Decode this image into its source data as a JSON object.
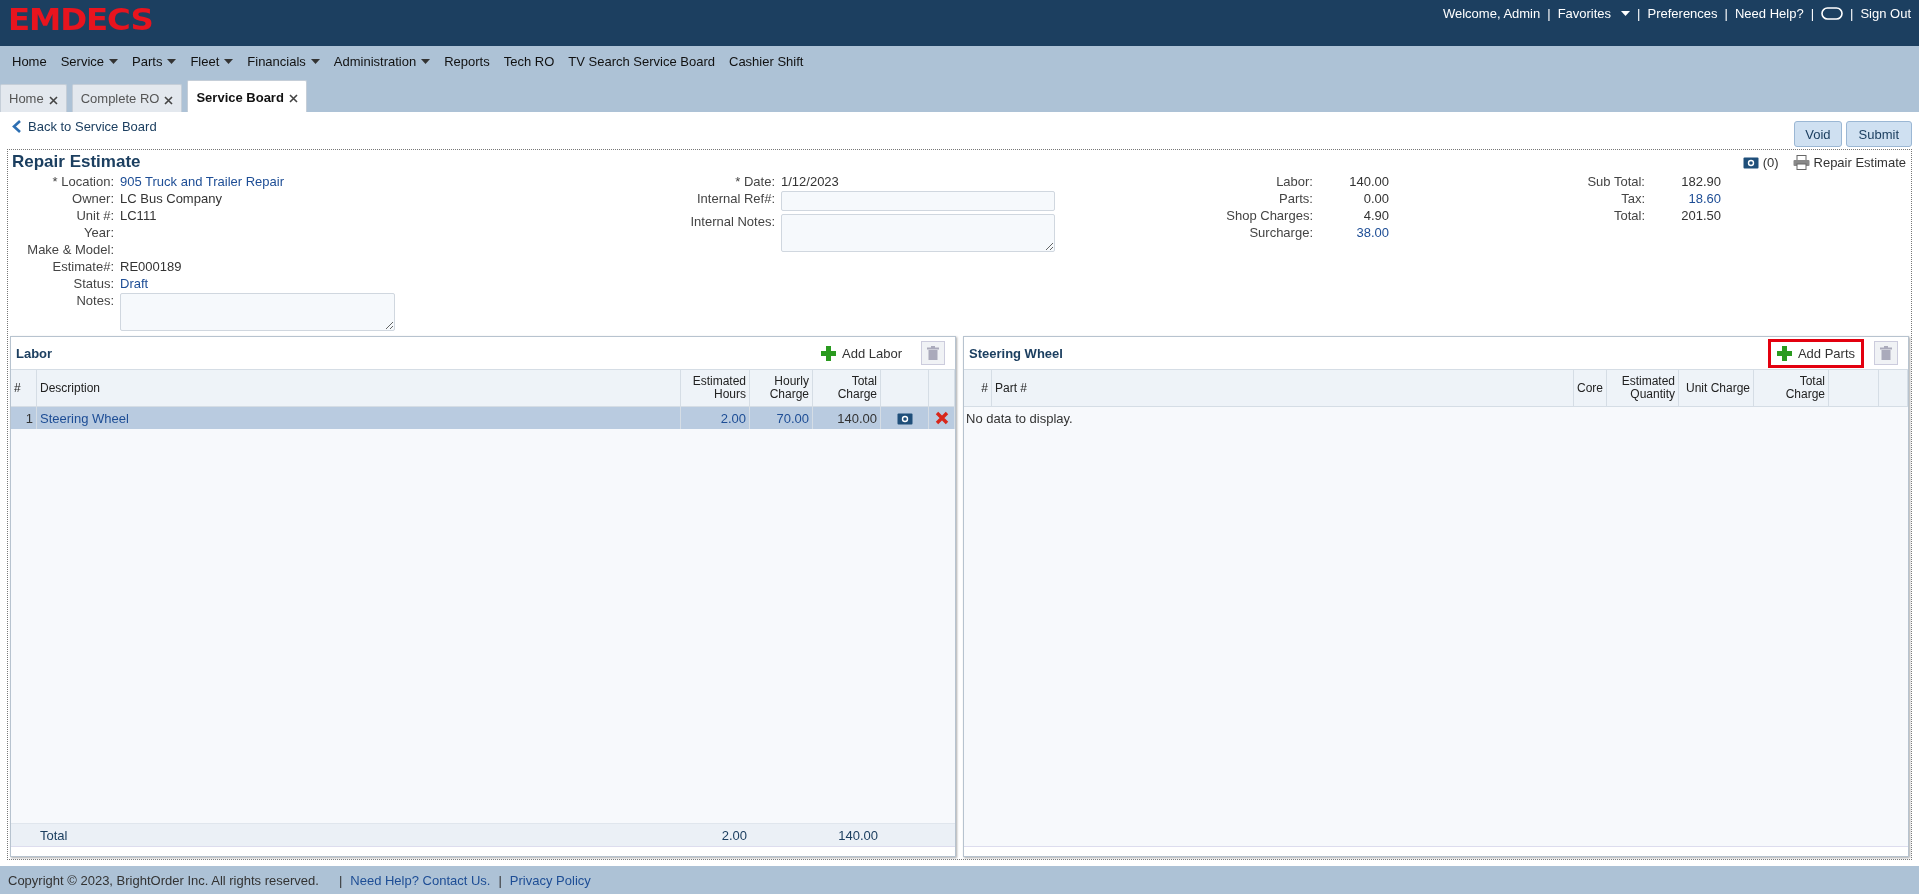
{
  "app": {
    "logo": "EMDECS"
  },
  "user_menu": {
    "separator": "|",
    "items": [
      {
        "kind": "text",
        "label": "Welcome, Admin"
      },
      {
        "kind": "dropdown",
        "label": "Favorites"
      },
      {
        "kind": "link",
        "label": "Preferences"
      },
      {
        "kind": "link",
        "label": "Need Help?"
      },
      {
        "kind": "chat"
      },
      {
        "kind": "link",
        "label": "Sign Out"
      }
    ]
  },
  "nav": [
    {
      "label": "Home",
      "dropdown": false
    },
    {
      "label": "Service",
      "dropdown": true
    },
    {
      "label": "Parts",
      "dropdown": true
    },
    {
      "label": "Fleet",
      "dropdown": true
    },
    {
      "label": "Financials",
      "dropdown": true
    },
    {
      "label": "Administration",
      "dropdown": true
    },
    {
      "label": "Reports",
      "dropdown": false
    },
    {
      "label": "Tech RO",
      "dropdown": false
    },
    {
      "label": "TV Search Service Board",
      "dropdown": false
    },
    {
      "label": "Cashier Shift",
      "dropdown": false
    }
  ],
  "tabs": [
    {
      "label": "Home",
      "selected": false
    },
    {
      "label": "Complete RO",
      "selected": false
    },
    {
      "label": "Service Board",
      "selected": true
    }
  ],
  "back_link": "Back to Service Board",
  "actions": [
    "Void",
    "Submit"
  ],
  "estimate": {
    "title": "Repair Estimate",
    "photo_count": "(0)",
    "print_label": "Repair Estimate",
    "fields_left": [
      {
        "label": "* Location:",
        "kind": "link",
        "value": "905 Truck and Trailer Repair"
      },
      {
        "label": "Owner:",
        "kind": "text",
        "value": "LC Bus Company"
      },
      {
        "label": "Unit #:",
        "kind": "text",
        "value": "LC111"
      },
      {
        "label": "Year:",
        "kind": "text"
      },
      {
        "label": "Make & Model:",
        "kind": "text"
      },
      {
        "label": "Estimate#:",
        "kind": "text",
        "value": "RE000189"
      },
      {
        "label": "Status:",
        "kind": "link",
        "value": "Draft"
      },
      {
        "label": "Notes:",
        "kind": "textarea"
      }
    ],
    "fields_mid": [
      {
        "label": "* Date:",
        "kind": "text",
        "value": "1/12/2023"
      },
      {
        "label": "Internal Ref#:",
        "kind": "input"
      },
      {
        "label": "Internal Notes:",
        "kind": "textarea"
      }
    ],
    "totals_1": [
      {
        "label": "Labor:",
        "kind": "text",
        "value": "140.00"
      },
      {
        "label": "Parts:",
        "kind": "text",
        "value": "0.00"
      },
      {
        "label": "Shop Charges:",
        "kind": "text",
        "value": "4.90"
      },
      {
        "label": "Surcharge:",
        "kind": "link",
        "value": "38.00"
      }
    ],
    "totals_2": [
      {
        "label": "Sub Total:",
        "kind": "text",
        "value": "182.90"
      },
      {
        "label": "Tax:",
        "kind": "link",
        "value": "18.60"
      },
      {
        "label": "Total:",
        "kind": "text",
        "value": "201.50"
      }
    ]
  },
  "labor": {
    "title": "Labor",
    "add_button": {
      "label": "Add Labor",
      "highlighted": false
    },
    "columns": [
      "#",
      "Description",
      "Estimated Hours",
      "Hourly Charge",
      "Total Charge"
    ],
    "rows": [
      {
        "cells": [
          "1",
          "Steering Wheel",
          "2.00",
          "70.00",
          "140.00"
        ],
        "selected": true
      }
    ],
    "totals": {
      "label": "Total",
      "hours": "2.00",
      "charge": "140.00"
    }
  },
  "parts": {
    "title": "Steering Wheel",
    "add_button": {
      "label": "Add Parts",
      "highlighted": true
    },
    "columns": [
      "#",
      "Part #",
      "Core",
      "Estimated Quantity",
      "Unit Charge",
      "Total Charge"
    ],
    "empty_text": "No data to display."
  },
  "footer": {
    "copyright": "Copyright © 2023, BrightOrder Inc. All rights reserved.",
    "separator": "|",
    "links": [
      "Need Help? Contact Us.",
      "Privacy Policy"
    ]
  }
}
